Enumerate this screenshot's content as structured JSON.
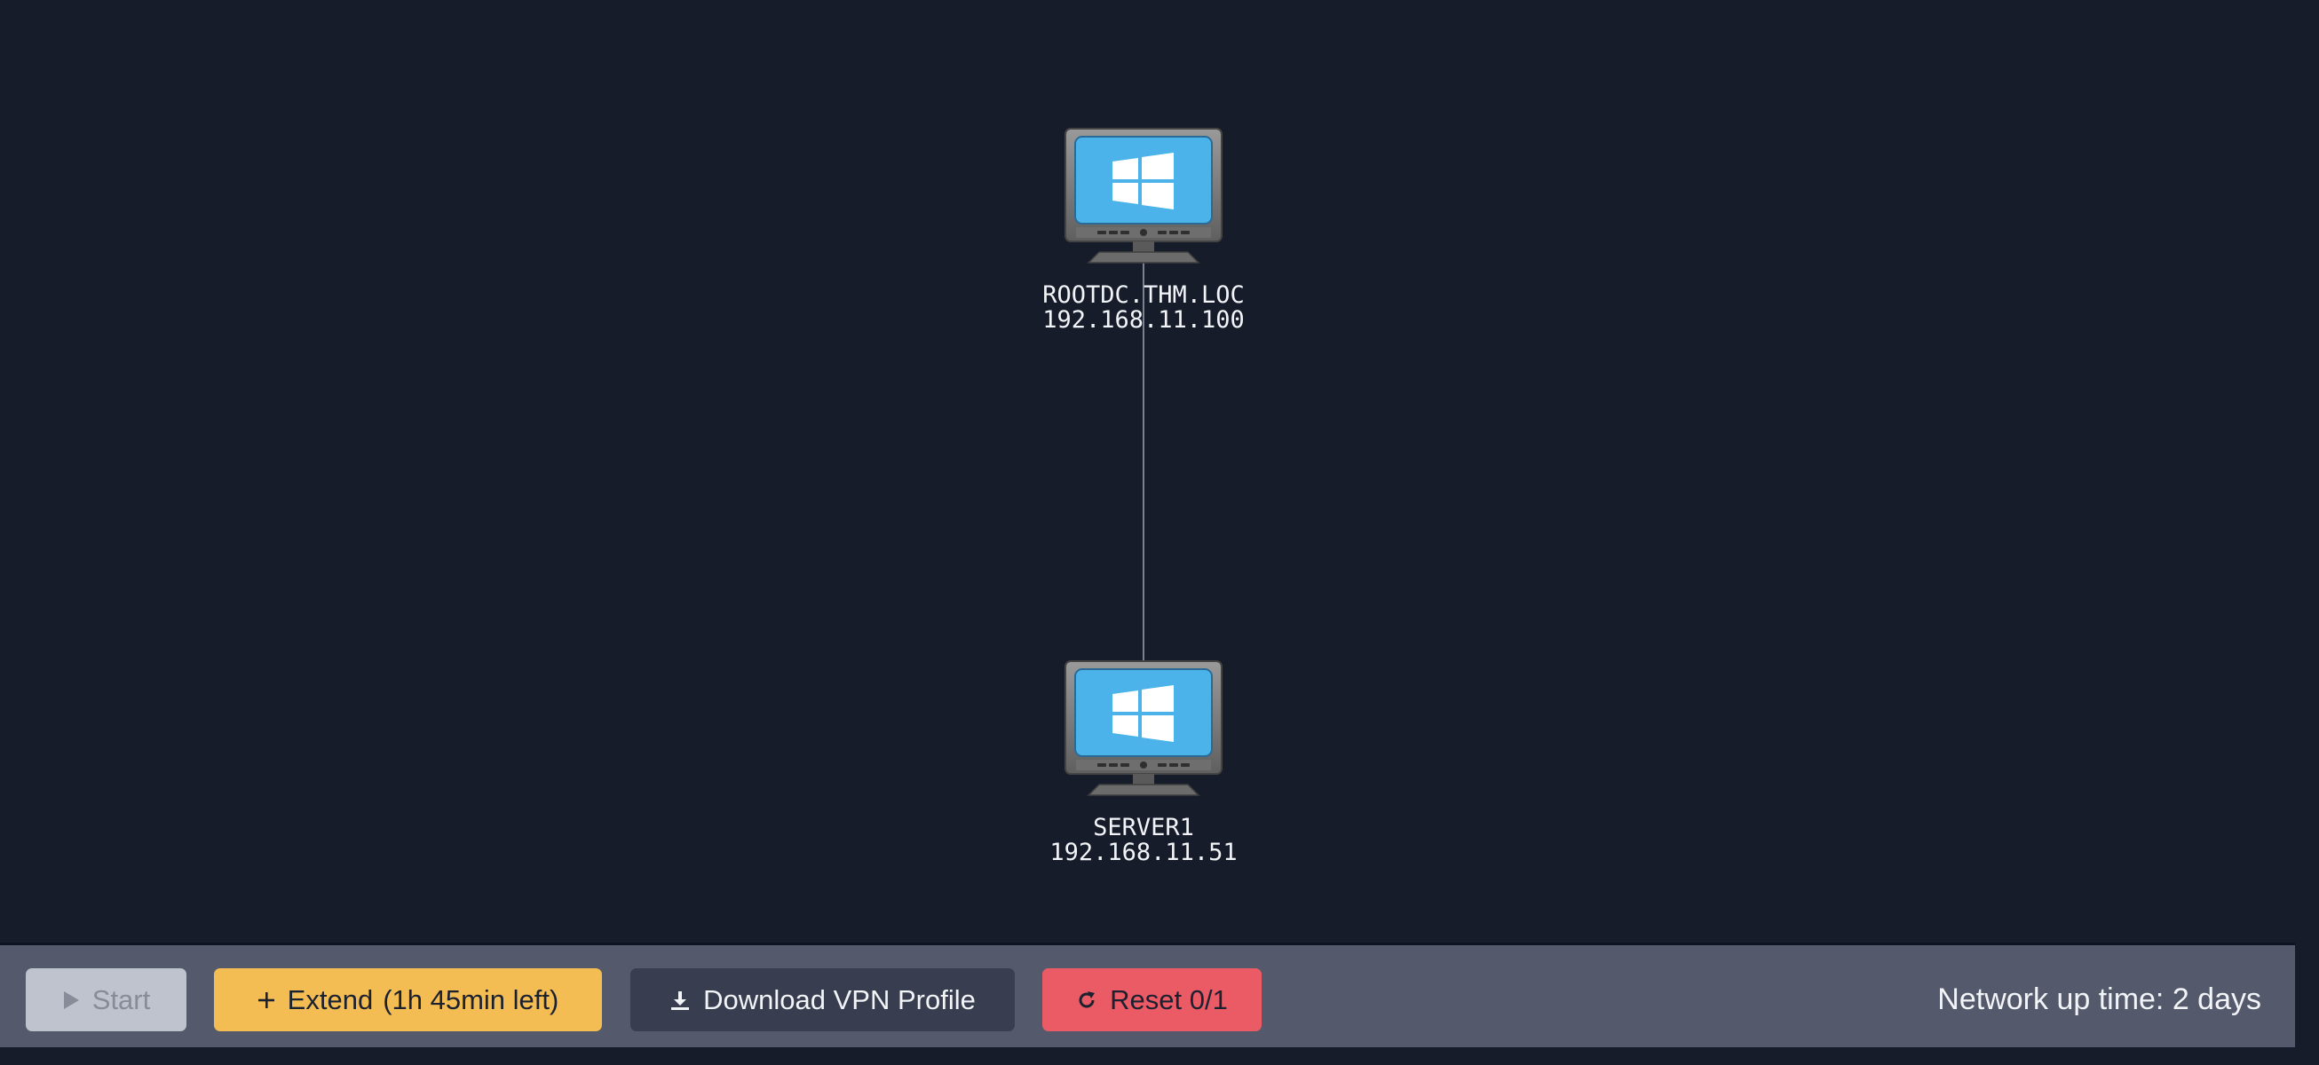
{
  "network_map": {
    "nodes": [
      {
        "hostname": "ROOTDC.THM.LOC",
        "ip": "192.168.11.100",
        "icon": "windows-monitor-icon"
      },
      {
        "hostname": "SERVER1",
        "ip": "192.168.11.51",
        "icon": "windows-monitor-icon"
      }
    ],
    "colors": {
      "background": "#171c2b",
      "link": "#7b8190",
      "screen": "#4cb2ea"
    }
  },
  "toolbar": {
    "start_label": "Start",
    "start_icon": "play-icon",
    "extend_label": "Extend",
    "extend_remaining": "(1h 45min left)",
    "extend_icon": "plus-icon",
    "vpn_label": "Download VPN Profile",
    "vpn_icon": "download-icon",
    "reset_label": "Reset 0/1",
    "reset_icon": "refresh-icon",
    "uptime": "Network up time: 2 days",
    "colors": {
      "extend": "#f3bd53",
      "vpn": "#383e4f",
      "reset": "#ea5b66",
      "start_disabled": "#bfc3cd",
      "bar": "#545a6b"
    }
  }
}
